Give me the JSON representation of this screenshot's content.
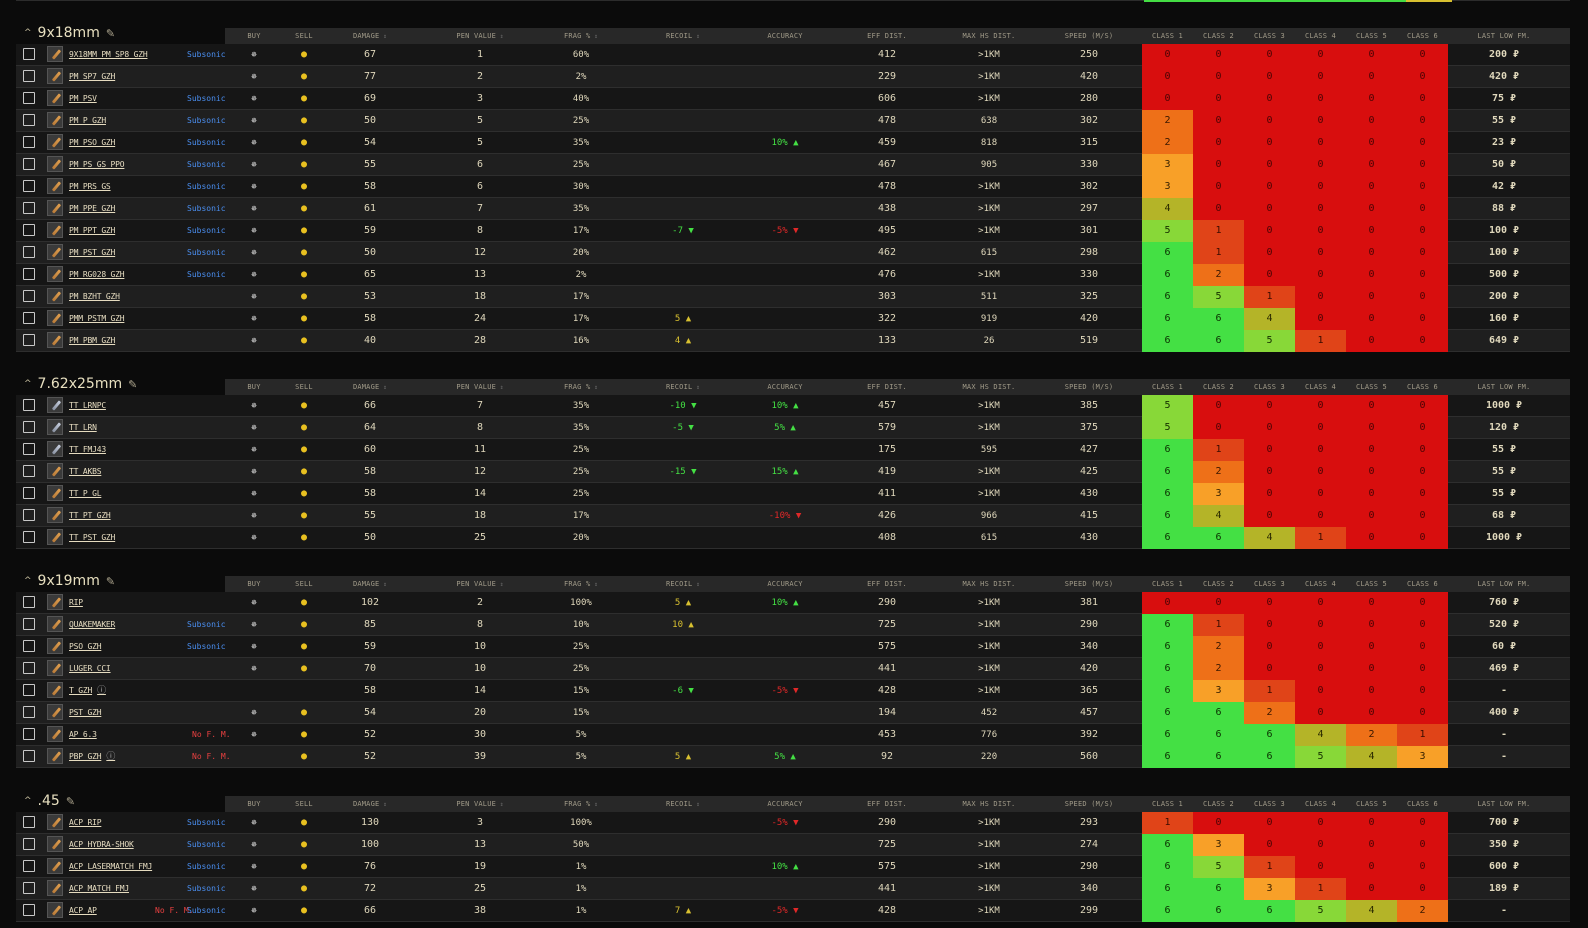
{
  "columns": {
    "buy": "BUY",
    "sell": "SELL",
    "damage": "DAMAGE",
    "pen": "PEN VALUE",
    "frag": "FRAG %",
    "recoil": "RECOIL",
    "accuracy": "ACCURACY",
    "eff": "EFF DIST.",
    "maxhs": "MAX HS DIST.",
    "speed": "SPEED (M/S)",
    "class1": "CLASS 1",
    "class2": "CLASS 2",
    "class3": "CLASS 3",
    "class4": "CLASS 4",
    "class5": "CLASS 5",
    "class6": "CLASS 6",
    "price": "LAST LOW FM."
  },
  "colors": {
    "class_0": "#d80e0e",
    "class_1": "#e04418",
    "class_2": "#ee7018",
    "class_3": "#f8a028",
    "class_4": "#b4b428",
    "class_5": "#88d838",
    "class_6": "#44e044",
    "subsonic": "#4a8ef0",
    "no_fm": "#e84040",
    "positive": "#44e044",
    "negative": "#e02828",
    "neutral_up": "#d8c030"
  },
  "icons": {
    "collapse": "chevron-up-icon",
    "edit": "pen-icon",
    "buy": "trade-icon",
    "sell": "coin-icon",
    "info": "info-icon",
    "up": "triangle-up-icon",
    "down": "triangle-down-icon"
  },
  "sections": [
    {
      "title": "9x18mm",
      "rows": [
        {
          "name": "9X18MM PM SP8 GZH",
          "tag": "Subsonic",
          "buy": true,
          "sell": true,
          "damage": "67",
          "pen": "1",
          "frag": "60%",
          "recoil": "",
          "recoil_dir": "",
          "acc": "",
          "acc_dir": "",
          "eff": "412",
          "maxhs": ">1KM",
          "speed": "250",
          "cls": [
            0,
            0,
            0,
            0,
            0,
            0
          ],
          "price": "200 ₽"
        },
        {
          "name": "PM SP7 GZH",
          "tag": "",
          "buy": true,
          "sell": true,
          "damage": "77",
          "pen": "2",
          "frag": "2%",
          "recoil": "",
          "recoil_dir": "",
          "acc": "",
          "acc_dir": "",
          "eff": "229",
          "maxhs": ">1KM",
          "speed": "420",
          "cls": [
            0,
            0,
            0,
            0,
            0,
            0
          ],
          "price": "420 ₽"
        },
        {
          "name": "PM PSV",
          "tag": "Subsonic",
          "buy": true,
          "sell": true,
          "damage": "69",
          "pen": "3",
          "frag": "40%",
          "recoil": "",
          "recoil_dir": "",
          "acc": "",
          "acc_dir": "",
          "eff": "606",
          "maxhs": ">1KM",
          "speed": "280",
          "cls": [
            0,
            0,
            0,
            0,
            0,
            0
          ],
          "price": "75 ₽"
        },
        {
          "name": "PM P GZH",
          "tag": "Subsonic",
          "buy": true,
          "sell": true,
          "damage": "50",
          "pen": "5",
          "frag": "25%",
          "recoil": "",
          "recoil_dir": "",
          "acc": "",
          "acc_dir": "",
          "eff": "478",
          "maxhs": "638",
          "speed": "302",
          "cls": [
            2,
            0,
            0,
            0,
            0,
            0
          ],
          "price": "55 ₽"
        },
        {
          "name": "PM PSO GZH",
          "tag": "Subsonic",
          "buy": true,
          "sell": true,
          "damage": "54",
          "pen": "5",
          "frag": "35%",
          "recoil": "",
          "recoil_dir": "",
          "acc": "10%",
          "acc_dir": "up-good",
          "eff": "459",
          "maxhs": "818",
          "speed": "315",
          "cls": [
            2,
            0,
            0,
            0,
            0,
            0
          ],
          "price": "23 ₽"
        },
        {
          "name": "PM PS GS PPO",
          "tag": "Subsonic",
          "buy": true,
          "sell": true,
          "damage": "55",
          "pen": "6",
          "frag": "25%",
          "recoil": "",
          "recoil_dir": "",
          "acc": "",
          "acc_dir": "",
          "eff": "467",
          "maxhs": "905",
          "speed": "330",
          "cls": [
            3,
            0,
            0,
            0,
            0,
            0
          ],
          "price": "50 ₽"
        },
        {
          "name": "PM PRS GS",
          "tag": "Subsonic",
          "buy": true,
          "sell": true,
          "damage": "58",
          "pen": "6",
          "frag": "30%",
          "recoil": "",
          "recoil_dir": "",
          "acc": "",
          "acc_dir": "",
          "eff": "478",
          "maxhs": ">1KM",
          "speed": "302",
          "cls": [
            3,
            0,
            0,
            0,
            0,
            0
          ],
          "price": "42 ₽"
        },
        {
          "name": "PM PPE GZH",
          "tag": "Subsonic",
          "buy": true,
          "sell": true,
          "damage": "61",
          "pen": "7",
          "frag": "35%",
          "recoil": "",
          "recoil_dir": "",
          "acc": "",
          "acc_dir": "",
          "eff": "438",
          "maxhs": ">1KM",
          "speed": "297",
          "cls": [
            4,
            0,
            0,
            0,
            0,
            0
          ],
          "price": "88 ₽"
        },
        {
          "name": "PM PPT GZH",
          "tag": "Subsonic",
          "buy": true,
          "sell": true,
          "damage": "59",
          "pen": "8",
          "frag": "17%",
          "recoil": "-7",
          "recoil_dir": "down-good",
          "acc": "-5%",
          "acc_dir": "down-bad",
          "eff": "495",
          "maxhs": ">1KM",
          "speed": "301",
          "cls": [
            5,
            1,
            0,
            0,
            0,
            0
          ],
          "price": "100 ₽"
        },
        {
          "name": "PM PST GZH",
          "tag": "Subsonic",
          "buy": true,
          "sell": true,
          "damage": "50",
          "pen": "12",
          "frag": "20%",
          "recoil": "",
          "recoil_dir": "",
          "acc": "",
          "acc_dir": "",
          "eff": "462",
          "maxhs": "615",
          "speed": "298",
          "cls": [
            6,
            1,
            0,
            0,
            0,
            0
          ],
          "price": "100 ₽"
        },
        {
          "name": "PM RG028 GZH",
          "tag": "Subsonic",
          "buy": true,
          "sell": true,
          "damage": "65",
          "pen": "13",
          "frag": "2%",
          "recoil": "",
          "recoil_dir": "",
          "acc": "",
          "acc_dir": "",
          "eff": "476",
          "maxhs": ">1KM",
          "speed": "330",
          "cls": [
            6,
            2,
            0,
            0,
            0,
            0
          ],
          "price": "500 ₽"
        },
        {
          "name": "PM BZHT GZH",
          "tag": "",
          "buy": true,
          "sell": true,
          "damage": "53",
          "pen": "18",
          "frag": "17%",
          "recoil": "",
          "recoil_dir": "",
          "acc": "",
          "acc_dir": "",
          "eff": "303",
          "maxhs": "511",
          "speed": "325",
          "cls": [
            6,
            5,
            1,
            0,
            0,
            0
          ],
          "price": "200 ₽"
        },
        {
          "name": "PMM PSTM GZH",
          "tag": "",
          "buy": true,
          "sell": true,
          "damage": "58",
          "pen": "24",
          "frag": "17%",
          "recoil": "5",
          "recoil_dir": "up-neutral",
          "acc": "",
          "acc_dir": "",
          "eff": "322",
          "maxhs": "919",
          "speed": "420",
          "cls": [
            6,
            6,
            4,
            0,
            0,
            0
          ],
          "price": "160 ₽"
        },
        {
          "name": "PM PBM GZH",
          "tag": "",
          "buy": true,
          "sell": true,
          "damage": "40",
          "pen": "28",
          "frag": "16%",
          "recoil": "4",
          "recoil_dir": "up-neutral",
          "acc": "",
          "acc_dir": "",
          "eff": "133",
          "maxhs": "26",
          "speed": "519",
          "cls": [
            6,
            6,
            5,
            1,
            0,
            0
          ],
          "price": "649 ₽"
        }
      ]
    },
    {
      "title": "7.62x25mm",
      "rows": [
        {
          "name": "TT LRNPC",
          "tag": "",
          "buy": true,
          "sell": true,
          "damage": "66",
          "pen": "7",
          "frag": "35%",
          "recoil": "-10",
          "recoil_dir": "down-good",
          "acc": "10%",
          "acc_dir": "up-good",
          "eff": "457",
          "maxhs": ">1KM",
          "speed": "385",
          "cls": [
            5,
            0,
            0,
            0,
            0,
            0
          ],
          "price": "1000 ₽"
        },
        {
          "name": "TT LRN",
          "tag": "",
          "buy": true,
          "sell": true,
          "damage": "64",
          "pen": "8",
          "frag": "35%",
          "recoil": "-5",
          "recoil_dir": "down-good",
          "acc": "5%",
          "acc_dir": "up-good",
          "eff": "579",
          "maxhs": ">1KM",
          "speed": "375",
          "cls": [
            5,
            0,
            0,
            0,
            0,
            0
          ],
          "price": "120 ₽"
        },
        {
          "name": "TT FMJ43",
          "tag": "",
          "buy": true,
          "sell": true,
          "damage": "60",
          "pen": "11",
          "frag": "25%",
          "recoil": "",
          "recoil_dir": "",
          "acc": "",
          "acc_dir": "",
          "eff": "175",
          "maxhs": "595",
          "speed": "427",
          "cls": [
            6,
            1,
            0,
            0,
            0,
            0
          ],
          "price": "55 ₽"
        },
        {
          "name": "TT AKBS",
          "tag": "",
          "buy": true,
          "sell": true,
          "damage": "58",
          "pen": "12",
          "frag": "25%",
          "recoil": "-15",
          "recoil_dir": "down-good",
          "acc": "15%",
          "acc_dir": "up-good",
          "eff": "419",
          "maxhs": ">1KM",
          "speed": "425",
          "cls": [
            6,
            2,
            0,
            0,
            0,
            0
          ],
          "price": "55 ₽"
        },
        {
          "name": "TT P GL",
          "tag": "",
          "buy": true,
          "sell": true,
          "damage": "58",
          "pen": "14",
          "frag": "25%",
          "recoil": "",
          "recoil_dir": "",
          "acc": "",
          "acc_dir": "",
          "eff": "411",
          "maxhs": ">1KM",
          "speed": "430",
          "cls": [
            6,
            3,
            0,
            0,
            0,
            0
          ],
          "price": "55 ₽"
        },
        {
          "name": "TT PT GZH",
          "tag": "",
          "buy": true,
          "sell": true,
          "damage": "55",
          "pen": "18",
          "frag": "17%",
          "recoil": "",
          "recoil_dir": "",
          "acc": "-10%",
          "acc_dir": "down-bad",
          "eff": "426",
          "maxhs": "966",
          "speed": "415",
          "cls": [
            6,
            4,
            0,
            0,
            0,
            0
          ],
          "price": "68 ₽"
        },
        {
          "name": "TT PST GZH",
          "tag": "",
          "buy": true,
          "sell": true,
          "damage": "50",
          "pen": "25",
          "frag": "20%",
          "recoil": "",
          "recoil_dir": "",
          "acc": "",
          "acc_dir": "",
          "eff": "408",
          "maxhs": "615",
          "speed": "430",
          "cls": [
            6,
            6,
            4,
            1,
            0,
            0
          ],
          "price": "1000 ₽"
        }
      ]
    },
    {
      "title": "9x19mm",
      "rows": [
        {
          "name": "RIP",
          "tag": "",
          "buy": true,
          "sell": true,
          "damage": "102",
          "pen": "2",
          "frag": "100%",
          "recoil": "5",
          "recoil_dir": "up-neutral",
          "acc": "10%",
          "acc_dir": "up-good",
          "eff": "290",
          "maxhs": ">1KM",
          "speed": "381",
          "cls": [
            0,
            0,
            0,
            0,
            0,
            0
          ],
          "price": "760 ₽"
        },
        {
          "name": "QUAKEMAKER",
          "tag": "Subsonic",
          "buy": true,
          "sell": true,
          "damage": "85",
          "pen": "8",
          "frag": "10%",
          "recoil": "10",
          "recoil_dir": "up-neutral",
          "acc": "",
          "acc_dir": "",
          "eff": "725",
          "maxhs": ">1KM",
          "speed": "290",
          "cls": [
            6,
            1,
            0,
            0,
            0,
            0
          ],
          "price": "520 ₽"
        },
        {
          "name": "PSO GZH",
          "tag": "Subsonic",
          "buy": true,
          "sell": true,
          "damage": "59",
          "pen": "10",
          "frag": "25%",
          "recoil": "",
          "recoil_dir": "",
          "acc": "",
          "acc_dir": "",
          "eff": "575",
          "maxhs": ">1KM",
          "speed": "340",
          "cls": [
            6,
            2,
            0,
            0,
            0,
            0
          ],
          "price": "60 ₽"
        },
        {
          "name": "LUGER CCI",
          "tag": "",
          "buy": true,
          "sell": true,
          "damage": "70",
          "pen": "10",
          "frag": "25%",
          "recoil": "",
          "recoil_dir": "",
          "acc": "",
          "acc_dir": "",
          "eff": "441",
          "maxhs": ">1KM",
          "speed": "420",
          "cls": [
            6,
            2,
            0,
            0,
            0,
            0
          ],
          "price": "469 ₽"
        },
        {
          "name": "T GZH",
          "info": true,
          "tag": "",
          "buy": false,
          "sell": false,
          "damage": "58",
          "pen": "14",
          "frag": "15%",
          "recoil": "-6",
          "recoil_dir": "down-good",
          "acc": "-5%",
          "acc_dir": "down-bad",
          "eff": "428",
          "maxhs": ">1KM",
          "speed": "365",
          "cls": [
            6,
            3,
            1,
            0,
            0,
            0
          ],
          "price": "-"
        },
        {
          "name": "PST GZH",
          "tag": "",
          "buy": true,
          "sell": true,
          "damage": "54",
          "pen": "20",
          "frag": "15%",
          "recoil": "",
          "recoil_dir": "",
          "acc": "",
          "acc_dir": "",
          "eff": "194",
          "maxhs": "452",
          "speed": "457",
          "cls": [
            6,
            6,
            2,
            0,
            0,
            0
          ],
          "price": "400 ₽"
        },
        {
          "name": "AP 6.3",
          "tag": "",
          "nofm": "No F. M.",
          "buy": true,
          "sell": true,
          "damage": "52",
          "pen": "30",
          "frag": "5%",
          "recoil": "",
          "recoil_dir": "",
          "acc": "",
          "acc_dir": "",
          "eff": "453",
          "maxhs": "776",
          "speed": "392",
          "cls": [
            6,
            6,
            6,
            4,
            2,
            1
          ],
          "price": "-"
        },
        {
          "name": "PBP GZH",
          "info": true,
          "tag": "",
          "nofm": "No F. M.",
          "buy": false,
          "sell": true,
          "damage": "52",
          "pen": "39",
          "frag": "5%",
          "recoil": "5",
          "recoil_dir": "up-neutral",
          "acc": "5%",
          "acc_dir": "up-good",
          "eff": "92",
          "maxhs": "220",
          "speed": "560",
          "cls": [
            6,
            6,
            6,
            5,
            4,
            3
          ],
          "price": "-"
        }
      ]
    },
    {
      "title": ".45",
      "rows": [
        {
          "name": "ACP RIP",
          "tag": "Subsonic",
          "buy": true,
          "sell": true,
          "damage": "130",
          "pen": "3",
          "frag": "100%",
          "recoil": "",
          "recoil_dir": "",
          "acc": "-5%",
          "acc_dir": "down-bad",
          "eff": "290",
          "maxhs": ">1KM",
          "speed": "293",
          "cls": [
            1,
            0,
            0,
            0,
            0,
            0
          ],
          "price": "700 ₽"
        },
        {
          "name": "ACP HYDRA-SHOK",
          "tag": "Subsonic",
          "buy": true,
          "sell": true,
          "damage": "100",
          "pen": "13",
          "frag": "50%",
          "recoil": "",
          "recoil_dir": "",
          "acc": "",
          "acc_dir": "",
          "eff": "725",
          "maxhs": ">1KM",
          "speed": "274",
          "cls": [
            6,
            3,
            0,
            0,
            0,
            0
          ],
          "price": "350 ₽"
        },
        {
          "name": "ACP LASERMATCH FMJ",
          "tag": "Subsonic",
          "buy": true,
          "sell": true,
          "damage": "76",
          "pen": "19",
          "frag": "1%",
          "recoil": "",
          "recoil_dir": "",
          "acc": "10%",
          "acc_dir": "up-good",
          "eff": "575",
          "maxhs": ">1KM",
          "speed": "290",
          "cls": [
            6,
            5,
            1,
            0,
            0,
            0
          ],
          "price": "600 ₽"
        },
        {
          "name": "ACP MATCH FMJ",
          "tag": "Subsonic",
          "buy": true,
          "sell": true,
          "damage": "72",
          "pen": "25",
          "frag": "1%",
          "recoil": "",
          "recoil_dir": "",
          "acc": "",
          "acc_dir": "",
          "eff": "441",
          "maxhs": ">1KM",
          "speed": "340",
          "cls": [
            6,
            6,
            3,
            1,
            0,
            0
          ],
          "price": "189 ₽"
        },
        {
          "name": "ACP AP",
          "tag": "Subsonic",
          "nofm": "No F. M.",
          "buy": true,
          "sell": true,
          "damage": "66",
          "pen": "38",
          "frag": "1%",
          "recoil": "7",
          "recoil_dir": "up-neutral",
          "acc": "-5%",
          "acc_dir": "down-bad",
          "eff": "428",
          "maxhs": ">1KM",
          "speed": "299",
          "cls": [
            6,
            6,
            6,
            5,
            4,
            2
          ],
          "price": "-"
        }
      ]
    }
  ]
}
